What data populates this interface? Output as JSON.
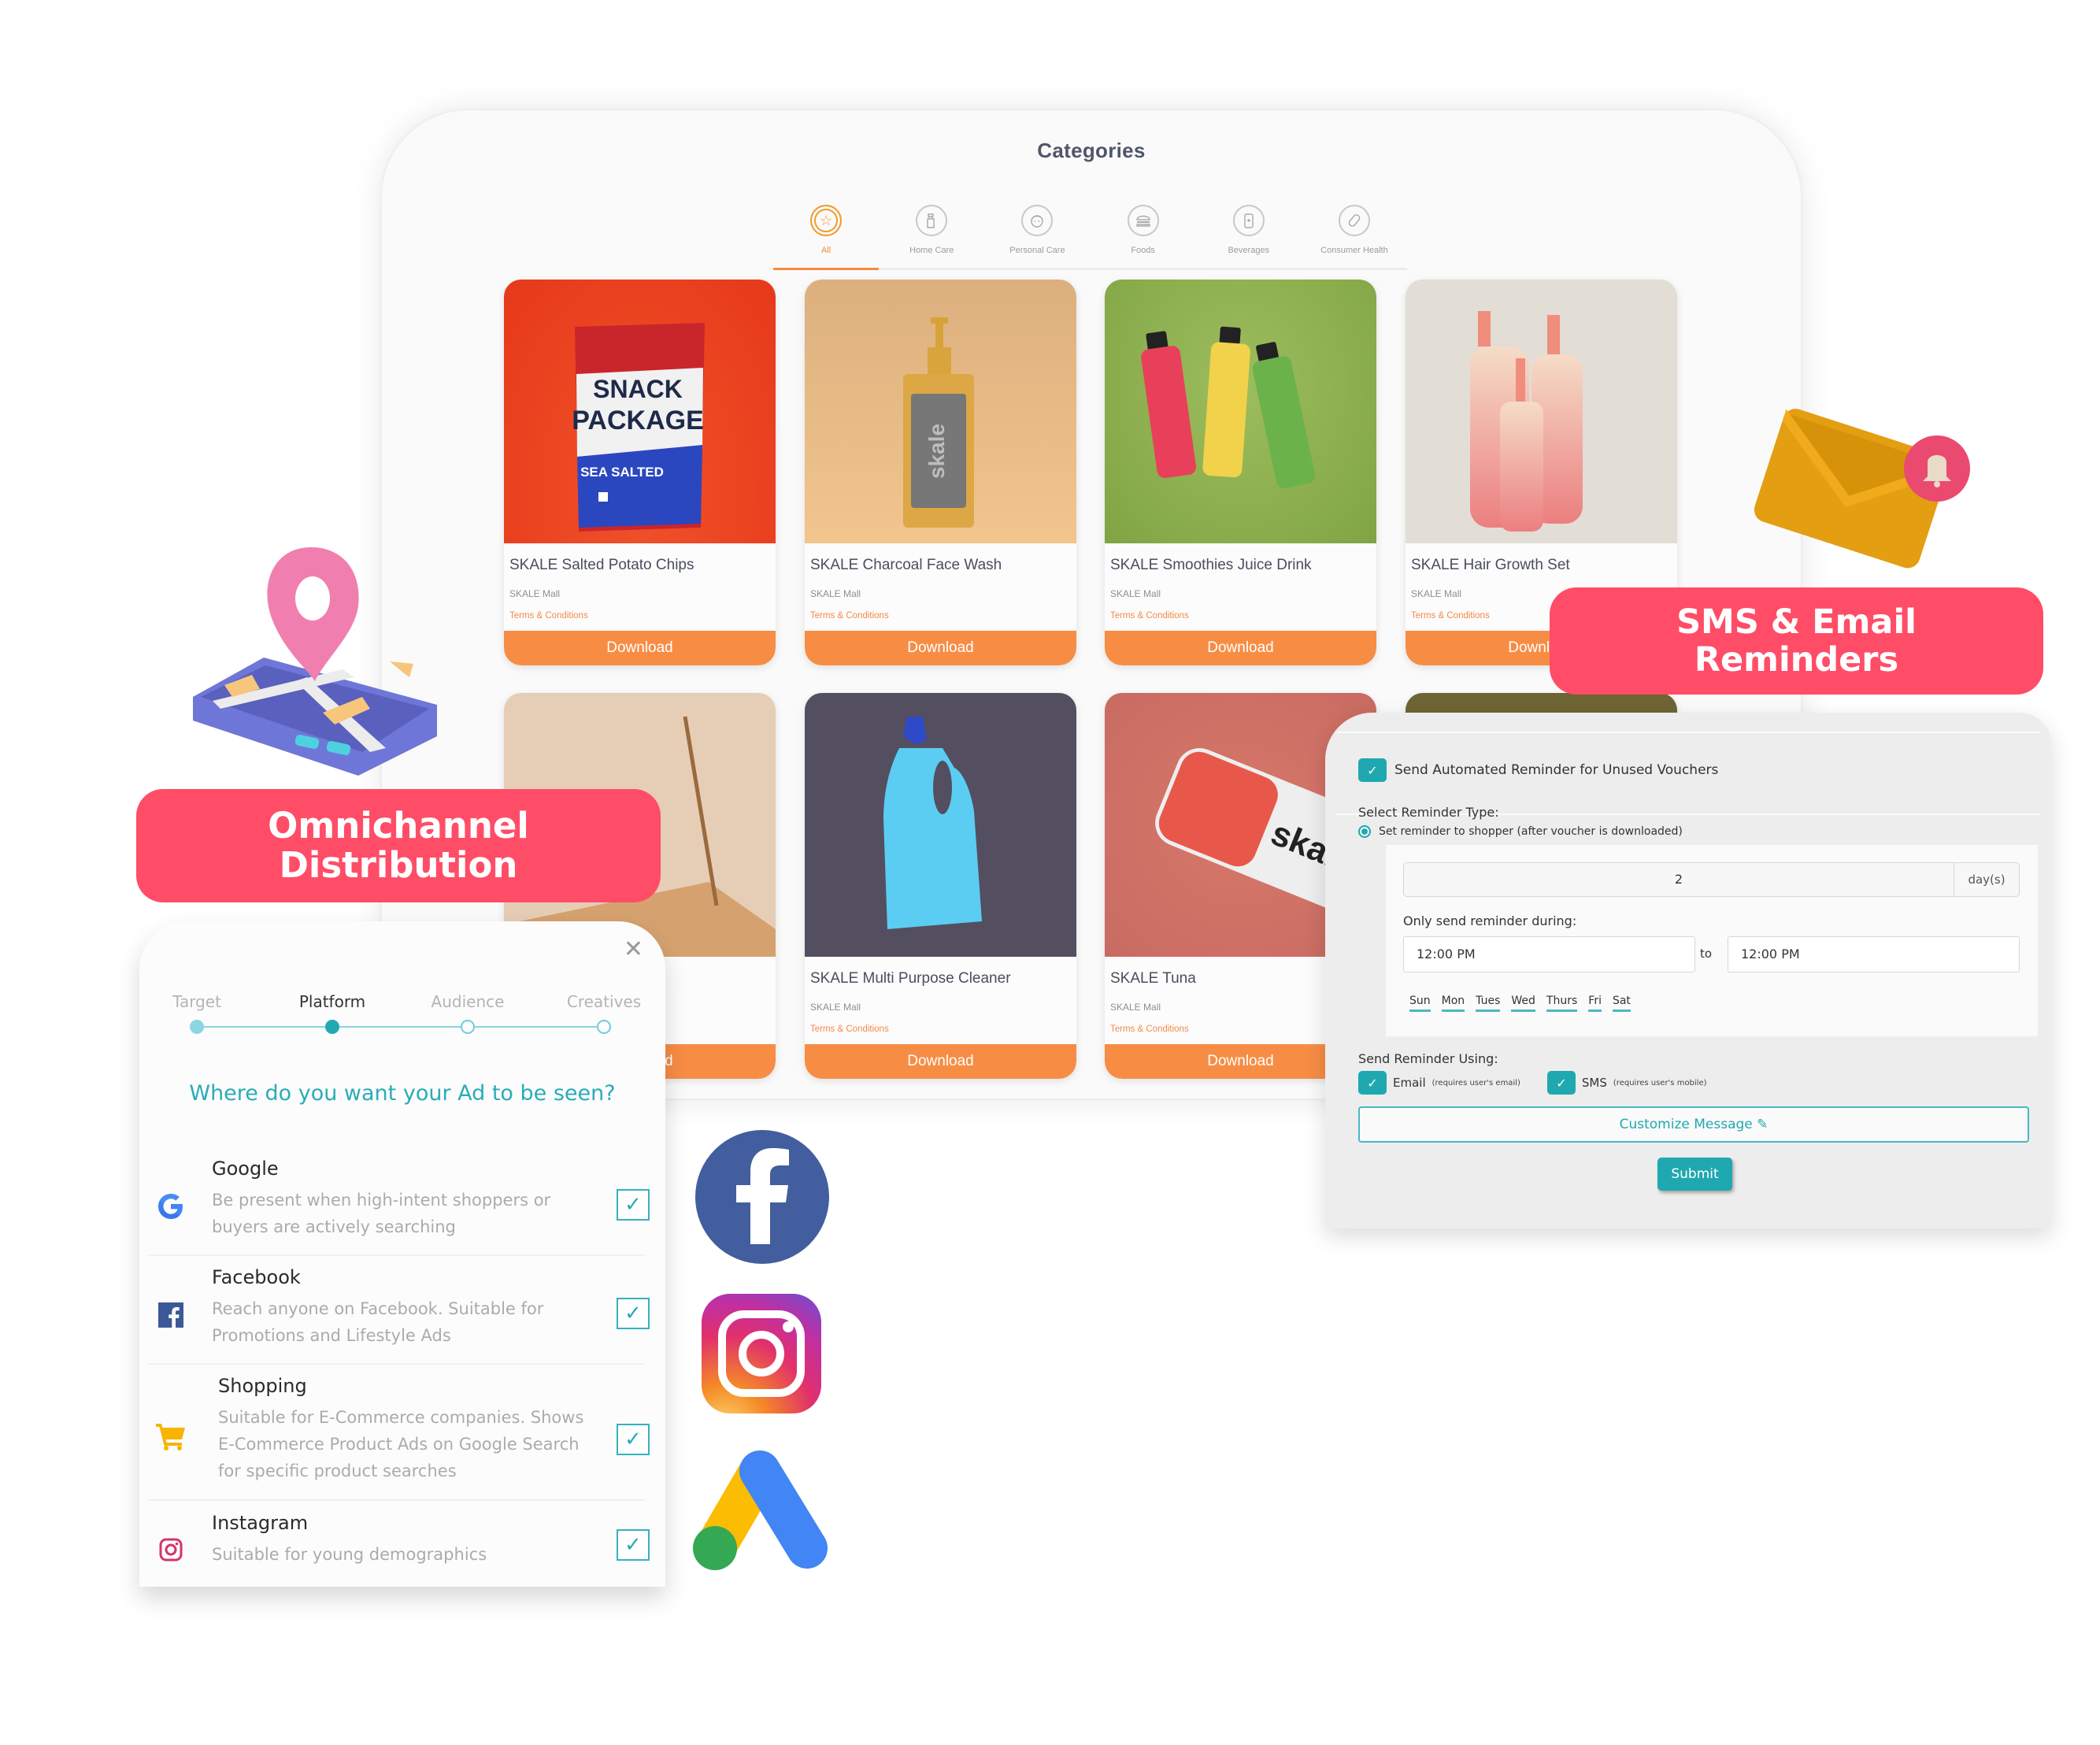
{
  "categories_window": {
    "title": "Categories",
    "tabs": [
      {
        "label": "All",
        "icon": "star-icon",
        "active": true
      },
      {
        "label": "Home Care",
        "icon": "spray-bottle-icon",
        "active": false
      },
      {
        "label": "Personal Care",
        "icon": "face-icon",
        "active": false
      },
      {
        "label": "Foods",
        "icon": "burger-icon",
        "active": false
      },
      {
        "label": "Beverages",
        "icon": "can-icon",
        "active": false
      },
      {
        "label": "Consumer Health",
        "icon": "pill-icon",
        "active": false
      }
    ],
    "products": [
      {
        "name": "SKALE Salted Potato Chips",
        "vendor": "SKALE Mall",
        "terms": "Terms & Conditions",
        "button": "Download",
        "image": "snack-package",
        "bag_text_1": "SNACK",
        "bag_text_2": "PACKAGE",
        "bag_text_3": "SEA SALTED"
      },
      {
        "name": "SKALE Charcoal Face Wash",
        "vendor": "SKALE Mall",
        "terms": "Terms & Conditions",
        "button": "Download",
        "image": "pump-bottle",
        "bottle_text": "skale"
      },
      {
        "name": "SKALE Smoothies Juice Drink",
        "vendor": "SKALE Mall",
        "terms": "Terms & Conditions",
        "button": "Download",
        "image": "juice-bottles"
      },
      {
        "name": "SKALE Hair Growth Set",
        "vendor": "SKALE Mall",
        "terms": "Terms & Conditions",
        "button": "Download",
        "image": "cosmetic-bottles"
      },
      {
        "name": "",
        "vendor": "",
        "terms": "",
        "button": "Download",
        "image": "honey-jar"
      },
      {
        "name": "SKALE Multi Purpose Cleaner",
        "vendor": "SKALE Mall",
        "terms": "Terms & Conditions",
        "button": "Download",
        "image": "cleaner-bottle"
      },
      {
        "name": "SKALE Tuna",
        "vendor": "SKALE Mall",
        "terms": "Terms & Conditions",
        "button": "Download",
        "image": "tuna-can",
        "can_text": "skale"
      }
    ]
  },
  "badges": {
    "omnichannel": [
      "Omnichannel",
      "Distribution"
    ],
    "sms_email": [
      "SMS & Email",
      "Reminders"
    ]
  },
  "reminder_panel": {
    "auto_reminder_label": "Send Automated Reminder for Unused Vouchers",
    "auto_reminder_checked": true,
    "select_type_label": "Select Reminder Type:",
    "type_option": "Set reminder to shopper (after voucher is downloaded)",
    "days_value": "2",
    "days_unit": "day(s)",
    "only_send_label": "Only send reminder during:",
    "time_from": "12:00 PM",
    "time_to_label": "to",
    "time_to": "12:00 PM",
    "weekdays": [
      "Sun",
      "Mon",
      "Tues",
      "Wed",
      "Thurs",
      "Fri",
      "Sat"
    ],
    "using_label": "Send Reminder Using:",
    "email_label": "Email",
    "email_note": "(requires user's email)",
    "email_checked": true,
    "sms_label": "SMS",
    "sms_note": "(requires user's mobile)",
    "sms_checked": true,
    "customize_button": "Customize Message",
    "submit_button": "Submit",
    "accent_color": "#20a8b0"
  },
  "ad_panel": {
    "steps": [
      {
        "label": "Target",
        "state": "done"
      },
      {
        "label": "Platform",
        "state": "current"
      },
      {
        "label": "Audience",
        "state": "todo"
      },
      {
        "label": "Creatives",
        "state": "todo"
      }
    ],
    "question": "Where do you want your Ad to be seen?",
    "platforms": [
      {
        "name": "Google",
        "description": "Be present when high-intent shoppers or buyers are actively searching",
        "icon": "google-icon",
        "checked": true
      },
      {
        "name": "Facebook",
        "description": "Reach anyone on Facebook. Suitable for Promotions and Lifestyle Ads",
        "icon": "facebook-icon",
        "checked": true
      },
      {
        "name": "Shopping",
        "description": "Suitable for E-Commerce companies. Shows E-Commerce Product Ads on Google Search for specific product searches",
        "icon": "shopping-cart-icon",
        "checked": true
      },
      {
        "name": "Instagram",
        "description": "Suitable for young demographics",
        "icon": "instagram-icon",
        "checked": true
      }
    ]
  },
  "colors": {
    "badge": "#ff4d68",
    "download": "#f78d45",
    "teal": "#20a8b0"
  }
}
